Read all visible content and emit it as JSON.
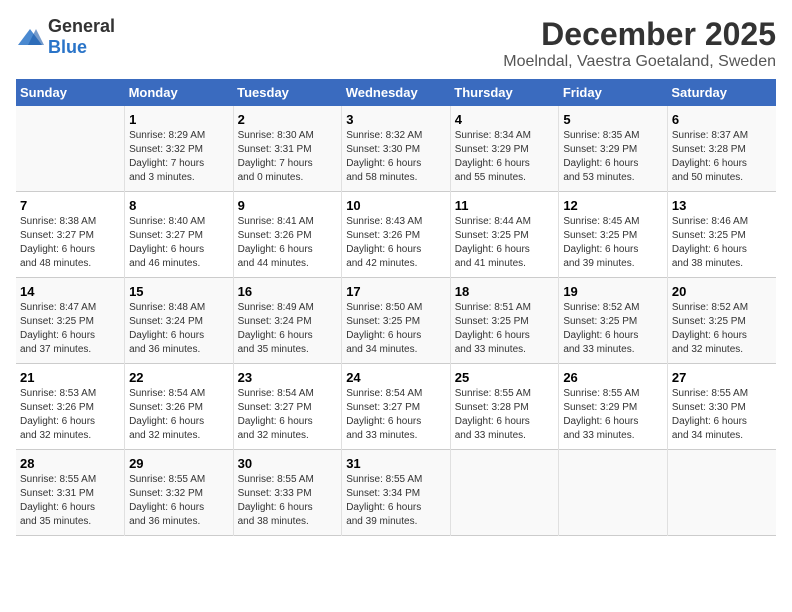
{
  "logo": {
    "text_general": "General",
    "text_blue": "Blue"
  },
  "header": {
    "title": "December 2025",
    "subtitle": "Moelndal, Vaestra Goetaland, Sweden"
  },
  "weekdays": [
    "Sunday",
    "Monday",
    "Tuesday",
    "Wednesday",
    "Thursday",
    "Friday",
    "Saturday"
  ],
  "weeks": [
    [
      {
        "day": "",
        "info": ""
      },
      {
        "day": "1",
        "info": "Sunrise: 8:29 AM\nSunset: 3:32 PM\nDaylight: 7 hours\nand 3 minutes."
      },
      {
        "day": "2",
        "info": "Sunrise: 8:30 AM\nSunset: 3:31 PM\nDaylight: 7 hours\nand 0 minutes."
      },
      {
        "day": "3",
        "info": "Sunrise: 8:32 AM\nSunset: 3:30 PM\nDaylight: 6 hours\nand 58 minutes."
      },
      {
        "day": "4",
        "info": "Sunrise: 8:34 AM\nSunset: 3:29 PM\nDaylight: 6 hours\nand 55 minutes."
      },
      {
        "day": "5",
        "info": "Sunrise: 8:35 AM\nSunset: 3:29 PM\nDaylight: 6 hours\nand 53 minutes."
      },
      {
        "day": "6",
        "info": "Sunrise: 8:37 AM\nSunset: 3:28 PM\nDaylight: 6 hours\nand 50 minutes."
      }
    ],
    [
      {
        "day": "7",
        "info": "Sunrise: 8:38 AM\nSunset: 3:27 PM\nDaylight: 6 hours\nand 48 minutes."
      },
      {
        "day": "8",
        "info": "Sunrise: 8:40 AM\nSunset: 3:27 PM\nDaylight: 6 hours\nand 46 minutes."
      },
      {
        "day": "9",
        "info": "Sunrise: 8:41 AM\nSunset: 3:26 PM\nDaylight: 6 hours\nand 44 minutes."
      },
      {
        "day": "10",
        "info": "Sunrise: 8:43 AM\nSunset: 3:26 PM\nDaylight: 6 hours\nand 42 minutes."
      },
      {
        "day": "11",
        "info": "Sunrise: 8:44 AM\nSunset: 3:25 PM\nDaylight: 6 hours\nand 41 minutes."
      },
      {
        "day": "12",
        "info": "Sunrise: 8:45 AM\nSunset: 3:25 PM\nDaylight: 6 hours\nand 39 minutes."
      },
      {
        "day": "13",
        "info": "Sunrise: 8:46 AM\nSunset: 3:25 PM\nDaylight: 6 hours\nand 38 minutes."
      }
    ],
    [
      {
        "day": "14",
        "info": "Sunrise: 8:47 AM\nSunset: 3:25 PM\nDaylight: 6 hours\nand 37 minutes."
      },
      {
        "day": "15",
        "info": "Sunrise: 8:48 AM\nSunset: 3:24 PM\nDaylight: 6 hours\nand 36 minutes."
      },
      {
        "day": "16",
        "info": "Sunrise: 8:49 AM\nSunset: 3:24 PM\nDaylight: 6 hours\nand 35 minutes."
      },
      {
        "day": "17",
        "info": "Sunrise: 8:50 AM\nSunset: 3:25 PM\nDaylight: 6 hours\nand 34 minutes."
      },
      {
        "day": "18",
        "info": "Sunrise: 8:51 AM\nSunset: 3:25 PM\nDaylight: 6 hours\nand 33 minutes."
      },
      {
        "day": "19",
        "info": "Sunrise: 8:52 AM\nSunset: 3:25 PM\nDaylight: 6 hours\nand 33 minutes."
      },
      {
        "day": "20",
        "info": "Sunrise: 8:52 AM\nSunset: 3:25 PM\nDaylight: 6 hours\nand 32 minutes."
      }
    ],
    [
      {
        "day": "21",
        "info": "Sunrise: 8:53 AM\nSunset: 3:26 PM\nDaylight: 6 hours\nand 32 minutes."
      },
      {
        "day": "22",
        "info": "Sunrise: 8:54 AM\nSunset: 3:26 PM\nDaylight: 6 hours\nand 32 minutes."
      },
      {
        "day": "23",
        "info": "Sunrise: 8:54 AM\nSunset: 3:27 PM\nDaylight: 6 hours\nand 32 minutes."
      },
      {
        "day": "24",
        "info": "Sunrise: 8:54 AM\nSunset: 3:27 PM\nDaylight: 6 hours\nand 33 minutes."
      },
      {
        "day": "25",
        "info": "Sunrise: 8:55 AM\nSunset: 3:28 PM\nDaylight: 6 hours\nand 33 minutes."
      },
      {
        "day": "26",
        "info": "Sunrise: 8:55 AM\nSunset: 3:29 PM\nDaylight: 6 hours\nand 33 minutes."
      },
      {
        "day": "27",
        "info": "Sunrise: 8:55 AM\nSunset: 3:30 PM\nDaylight: 6 hours\nand 34 minutes."
      }
    ],
    [
      {
        "day": "28",
        "info": "Sunrise: 8:55 AM\nSunset: 3:31 PM\nDaylight: 6 hours\nand 35 minutes."
      },
      {
        "day": "29",
        "info": "Sunrise: 8:55 AM\nSunset: 3:32 PM\nDaylight: 6 hours\nand 36 minutes."
      },
      {
        "day": "30",
        "info": "Sunrise: 8:55 AM\nSunset: 3:33 PM\nDaylight: 6 hours\nand 38 minutes."
      },
      {
        "day": "31",
        "info": "Sunrise: 8:55 AM\nSunset: 3:34 PM\nDaylight: 6 hours\nand 39 minutes."
      },
      {
        "day": "",
        "info": ""
      },
      {
        "day": "",
        "info": ""
      },
      {
        "day": "",
        "info": ""
      }
    ]
  ]
}
